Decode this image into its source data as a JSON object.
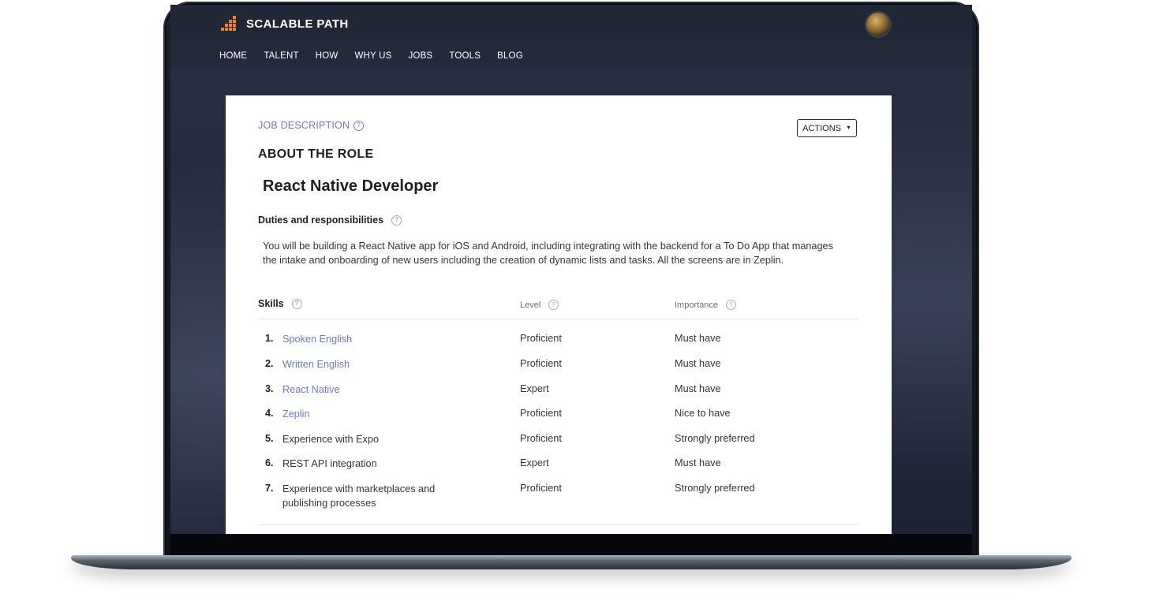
{
  "header": {
    "brand": "SCALABLE PATH",
    "brand_color": "#f58220"
  },
  "nav": {
    "items": [
      "HOME",
      "TALENT",
      "HOW",
      "WHY US",
      "JOBS",
      "TOOLS",
      "BLOG"
    ]
  },
  "card": {
    "section_label": "JOB DESCRIPTION",
    "help_glyph": "?",
    "actions_label": "ACTIONS",
    "about_heading": "ABOUT THE ROLE",
    "job_title": "React Native Developer",
    "duties_label": "Duties and responsibilities",
    "duties_text": "You will be building a React Native app for iOS and Android, including integrating with the backend for a To Do App that manages the intake and onboarding of new users including the creation of dynamic lists and tasks. All the screens are in Zeplin.",
    "skills_header": {
      "skills": "Skills",
      "level": "Level",
      "importance": "Importance"
    },
    "skills": [
      {
        "num": "1.",
        "name": "Spoken English",
        "level": "Proficient",
        "importance": "Must have"
      },
      {
        "num": "2.",
        "name": "Written English",
        "level": "Proficient",
        "importance": "Must have"
      },
      {
        "num": "3.",
        "name": "React Native",
        "level": "Expert",
        "importance": "Must have"
      },
      {
        "num": "4.",
        "name": "Zeplin",
        "level": "Proficient",
        "importance": "Nice to have"
      },
      {
        "num": "5.",
        "name": "Experience with Expo",
        "level": "Proficient",
        "importance": "Strongly preferred"
      },
      {
        "num": "6.",
        "name": "REST API integration",
        "level": "Expert",
        "importance": "Must have"
      },
      {
        "num": "7.",
        "name": "Experience with marketplaces and publishing processes",
        "level": "Proficient",
        "importance": "Strongly preferred"
      }
    ]
  }
}
